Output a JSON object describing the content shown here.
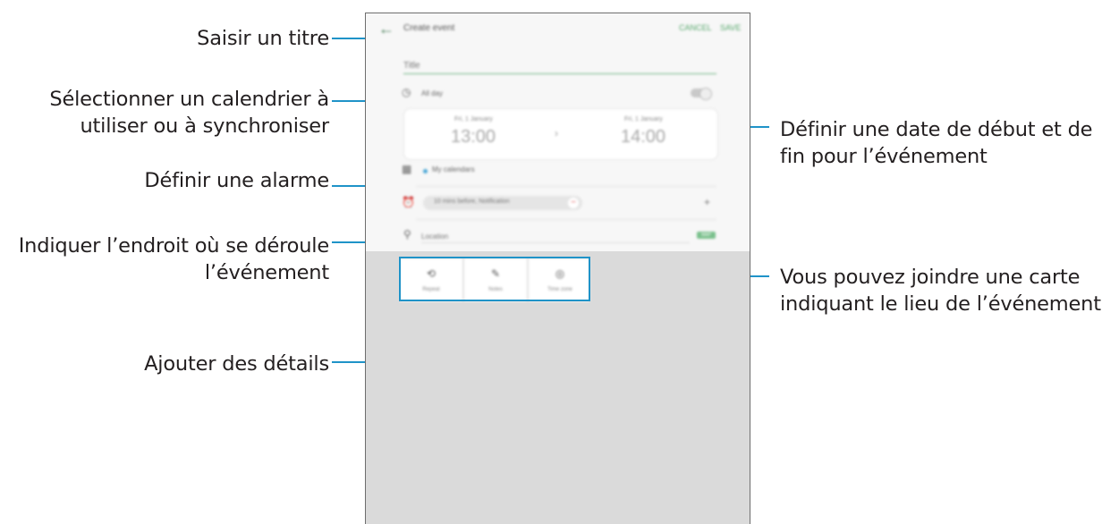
{
  "annotations": {
    "title": "Saisir un titre",
    "calendar_line1": "Sélectionner un calendrier à",
    "calendar_line2": "utiliser ou à synchroniser",
    "alarm": "Définir une alarme",
    "location_line1": "Indiquer l’endroit où se déroule",
    "location_line2": "l’événement",
    "details": "Ajouter des détails",
    "dates_line1": "Définir une date de début et de",
    "dates_line2": "fin pour l’événement",
    "map_line1": "Vous pouvez joindre une carte",
    "map_line2": "indiquant le lieu de l’événement"
  },
  "screen": {
    "app_title": "Create event",
    "cancel_label": "CANCEL",
    "save_label": "SAVE",
    "title_placeholder": "Title",
    "all_day_label": "All day",
    "all_day_on": false,
    "start": {
      "label": "Fri, 1 January",
      "time": "13:00"
    },
    "end": {
      "label": "Fri, 1 January",
      "time": "14:00"
    },
    "calendar_label": "My calendars",
    "calendar_color": "#4aa7d6",
    "alarm_text": "10 mins before, Notification",
    "location_placeholder": "Location",
    "map_label": "MAP",
    "details_buttons": [
      {
        "icon": "repeat-icon",
        "label": "Repeat"
      },
      {
        "icon": "notes-icon",
        "label": "Notes"
      },
      {
        "icon": "timezone-icon",
        "label": "Time zone"
      }
    ],
    "accent_color": "#58a86d",
    "callout_color": "#1f93c8"
  }
}
